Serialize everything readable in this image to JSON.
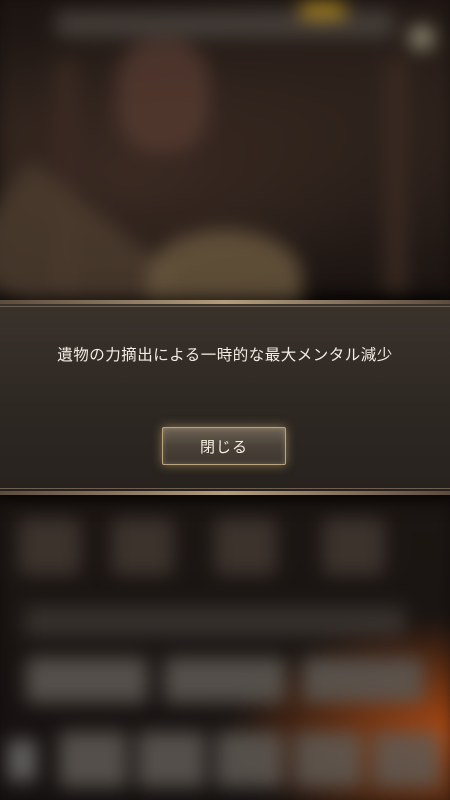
{
  "dialog": {
    "message": "遺物の力摘出による一時的な最大メンタル減少",
    "close_label": "閉じる"
  }
}
